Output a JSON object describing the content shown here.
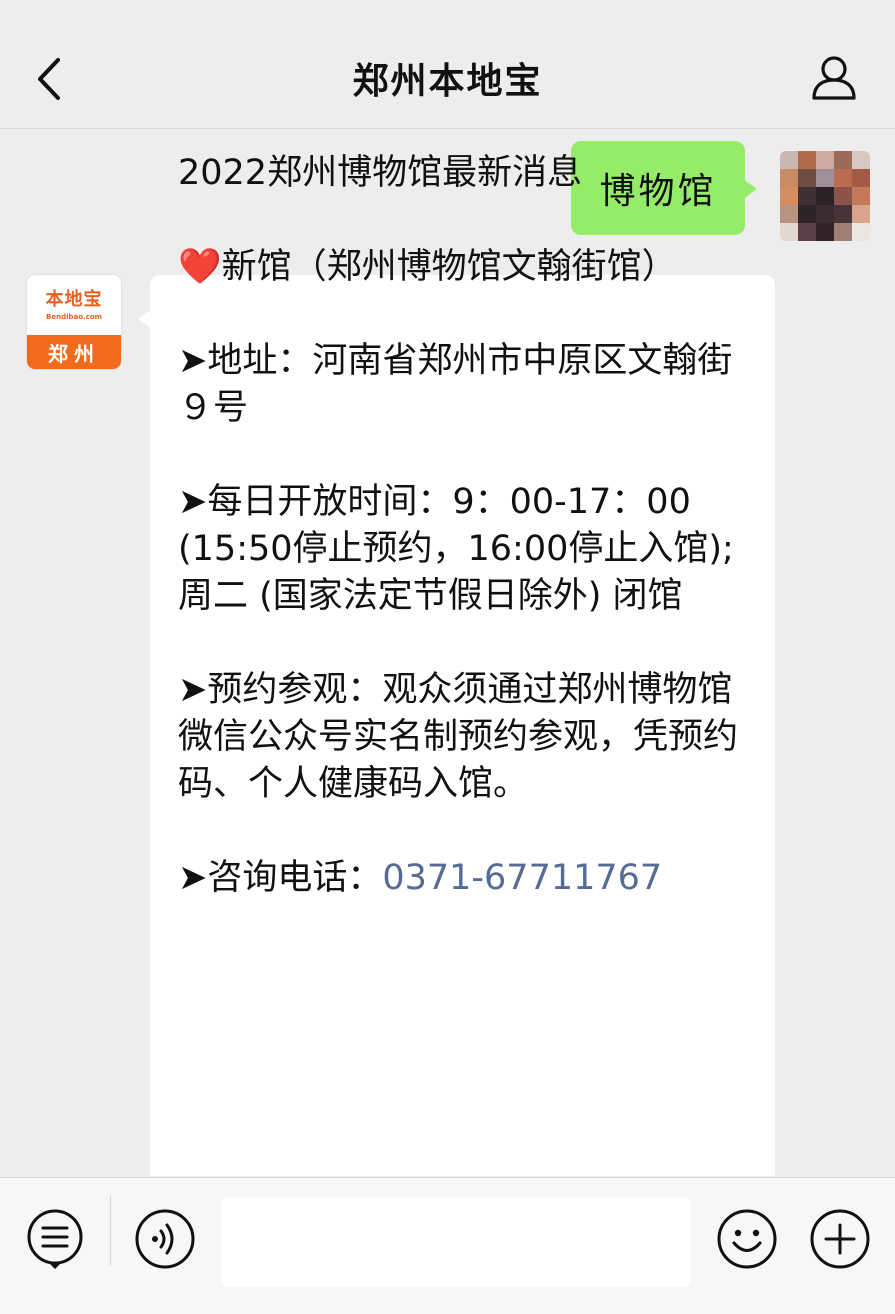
{
  "header": {
    "title": "郑州本地宝",
    "back_icon": "chevron-left-icon",
    "profile_icon": "person-icon"
  },
  "chat": {
    "user_message": "博物馆",
    "bot_avatar": {
      "logo_text": "本地宝",
      "logo_sub": "Bendibao.com",
      "city": "郑州"
    },
    "bot_message": {
      "title": "2022郑州博物馆最新消息",
      "heart": "❤️",
      "venue": "新馆（郑州博物馆文翰街馆）",
      "address": "➤地址：河南省郑州市中原区文翰街９号",
      "hours": "➤每日开放时间：9：00-17：00 (15:50停止预约，16:00停止入馆);周二 (国家法定节假日除外) 闭馆",
      "reservation": "➤预约参观：观众须通过郑州博物馆微信公众号实名制预约参观，凭预约码、个人健康码入馆。",
      "phone_label": "➤咨询电话：",
      "phone_number": "0371-67711767"
    }
  },
  "inputbar": {
    "menu_icon": "menu-list-icon",
    "voice_icon": "voice-icon",
    "emoji_icon": "smiley-icon",
    "add_icon": "plus-circle-icon",
    "input_value": ""
  },
  "colors": {
    "background": "#ededed",
    "user_bubble": "#95ec69",
    "bot_bubble": "#ffffff",
    "phone_link": "#566b95",
    "brand_orange": "#f26a1b"
  }
}
